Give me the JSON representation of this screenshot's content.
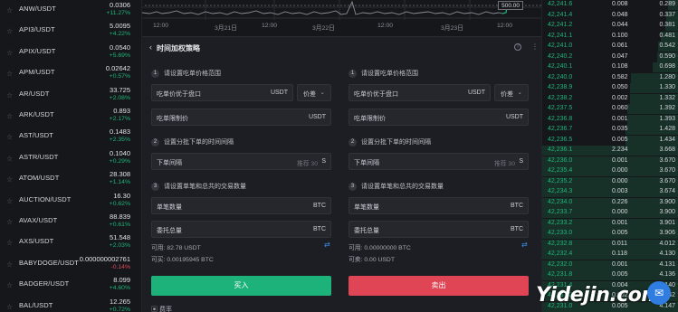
{
  "pairs": [
    {
      "name": "ANW/USDT",
      "price": "0.0306",
      "change": "+11.27%",
      "dir": "up"
    },
    {
      "name": "API3/USDT",
      "price": "5.0095",
      "change": "+4.22%",
      "dir": "up"
    },
    {
      "name": "APIX/USDT",
      "price": "0.0540",
      "change": "+5.69%",
      "dir": "up"
    },
    {
      "name": "APM/USDT",
      "price": "0.02642",
      "change": "+0.57%",
      "dir": "up"
    },
    {
      "name": "AR/USDT",
      "price": "33.725",
      "change": "+2.08%",
      "dir": "up"
    },
    {
      "name": "ARK/USDT",
      "price": "0.893",
      "change": "+2.17%",
      "dir": "up"
    },
    {
      "name": "AST/USDT",
      "price": "0.1483",
      "change": "+2.35%",
      "dir": "up"
    },
    {
      "name": "ASTR/USDT",
      "price": "0.1040",
      "change": "+0.29%",
      "dir": "up"
    },
    {
      "name": "ATOM/USDT",
      "price": "28.308",
      "change": "+1.14%",
      "dir": "up"
    },
    {
      "name": "AUCTION/USDT",
      "price": "16.30",
      "change": "+0.62%",
      "dir": "up"
    },
    {
      "name": "AVAX/USDT",
      "price": "88.839",
      "change": "+0.61%",
      "dir": "up"
    },
    {
      "name": "AXS/USDT",
      "price": "51.548",
      "change": "+2.03%",
      "dir": "up"
    },
    {
      "name": "BABYDOGE/USDT",
      "price": "0.000000002761",
      "change": "-0.14%",
      "dir": "down"
    },
    {
      "name": "BADGER/USDT",
      "price": "8.099",
      "change": "+4.60%",
      "dir": "up"
    },
    {
      "name": "BAL/USDT",
      "price": "12.265",
      "change": "+0.72%",
      "dir": "up"
    }
  ],
  "chart": {
    "x_labels": [
      "12:00",
      "3月21日",
      "12:00",
      "3月22日",
      "12:00",
      "3月23日",
      "12:00"
    ],
    "price_tag": "500.00"
  },
  "panel": {
    "title": "时间加权策略",
    "back_icon": "chevron-left-icon",
    "help_icon": "question-icon",
    "menu_icon": "more-vertical-icon",
    "buy": {
      "step1": "请设置吃单价格范围",
      "price_label": "吃单价优于盘口",
      "price_unit": "USDT",
      "price_select": "价差",
      "limit_label": "吃单限制价",
      "limit_unit": "USDT",
      "step2": "设置分批下单的时间间隔",
      "interval_label": "下单间隔",
      "interval_hint": "推荐 30",
      "interval_unit": "S",
      "step3": "请设置单笔和总共的交易数量",
      "single_label": "单笔数量",
      "single_unit": "BTC",
      "total_label": "委托总量",
      "total_unit": "BTC",
      "available": "可用: 82.78 USDT",
      "can_buy": "可买: 0.00195945 BTC",
      "button": "买入"
    },
    "sell": {
      "step1": "请设置吃单价格范围",
      "price_label": "吃单价优于盘口",
      "price_unit": "USDT",
      "price_select": "价差",
      "limit_label": "吃单限制价",
      "limit_unit": "USDT",
      "step2": "设置分批下单的时间间隔",
      "interval_label": "下单间隔",
      "interval_hint": "推荐 30",
      "interval_unit": "S",
      "step3": "请设置单笔和总共的交易数量",
      "single_label": "单笔数量",
      "single_unit": "BTC",
      "total_label": "委托总量",
      "total_unit": "BTC",
      "available": "可用: 0.00000000 BTC",
      "can_sell": "可卖: 0.00 USDT",
      "button": "卖出"
    },
    "fee": "费率"
  },
  "orderbook": [
    {
      "price": "42,241.6",
      "qty": "0.008",
      "total": "0.289",
      "depth": 0.08
    },
    {
      "price": "42,241.4",
      "qty": "0.048",
      "total": "0.337",
      "depth": 0.09
    },
    {
      "price": "42,241.2",
      "qty": "0.044",
      "total": "0.381",
      "depth": 0.1
    },
    {
      "price": "42,241.1",
      "qty": "0.100",
      "total": "0.481",
      "depth": 0.13
    },
    {
      "price": "42,241.0",
      "qty": "0.061",
      "total": "0.542",
      "depth": 0.15
    },
    {
      "price": "42,240.2",
      "qty": "0.047",
      "total": "0.590",
      "depth": 0.16
    },
    {
      "price": "42,240.1",
      "qty": "0.108",
      "total": "0.698",
      "depth": 0.19
    },
    {
      "price": "42,240.0",
      "qty": "0.582",
      "total": "1.280",
      "depth": 0.35
    },
    {
      "price": "42,238.9",
      "qty": "0.050",
      "total": "1.330",
      "depth": 0.36
    },
    {
      "price": "42,238.2",
      "qty": "0.002",
      "total": "1.332",
      "depth": 0.36
    },
    {
      "price": "42,237.5",
      "qty": "0.060",
      "total": "1.392",
      "depth": 0.38
    },
    {
      "price": "42,236.8",
      "qty": "0.001",
      "total": "1.393",
      "depth": 0.38
    },
    {
      "price": "42,236.7",
      "qty": "0.035",
      "total": "1.428",
      "depth": 0.39
    },
    {
      "price": "42,236.5",
      "qty": "0.005",
      "total": "1.434",
      "depth": 0.39
    },
    {
      "price": "42,236.1",
      "qty": "2.234",
      "total": "3.668",
      "depth": 1.0
    },
    {
      "price": "42,236.0",
      "qty": "0.001",
      "total": "3.670",
      "depth": 1.0
    },
    {
      "price": "42,235.4",
      "qty": "0.000",
      "total": "3.670",
      "depth": 1.0
    },
    {
      "price": "42,235.2",
      "qty": "0.000",
      "total": "3.670",
      "depth": 1.0
    },
    {
      "price": "42,234.3",
      "qty": "0.003",
      "total": "3.674",
      "depth": 1.0
    },
    {
      "price": "42,234.0",
      "qty": "0.226",
      "total": "3.900",
      "depth": 1.0
    },
    {
      "price": "42,233.7",
      "qty": "0.000",
      "total": "3.900",
      "depth": 1.0
    },
    {
      "price": "42,233.2",
      "qty": "0.001",
      "total": "3.901",
      "depth": 1.0
    },
    {
      "price": "42,233.0",
      "qty": "0.005",
      "total": "3.906",
      "depth": 1.0
    },
    {
      "price": "42,232.8",
      "qty": "0.011",
      "total": "4.012",
      "depth": 1.0
    },
    {
      "price": "42,232.4",
      "qty": "0.118",
      "total": "4.130",
      "depth": 1.0
    },
    {
      "price": "42,232.0",
      "qty": "0.001",
      "total": "4.131",
      "depth": 1.0
    },
    {
      "price": "42,231.8",
      "qty": "0.005",
      "total": "4.136",
      "depth": 1.0
    },
    {
      "price": "42,231.4",
      "qty": "0.004",
      "total": "4.140",
      "depth": 1.0
    },
    {
      "price": "42,231.2",
      "qty": "0.002",
      "total": "4.142",
      "depth": 1.0
    },
    {
      "price": "42,231.0",
      "qty": "0.005",
      "total": "4.147",
      "depth": 1.0
    }
  ],
  "watermark": "Yidejin.com",
  "fab_icon": "chat-bubble-icon"
}
